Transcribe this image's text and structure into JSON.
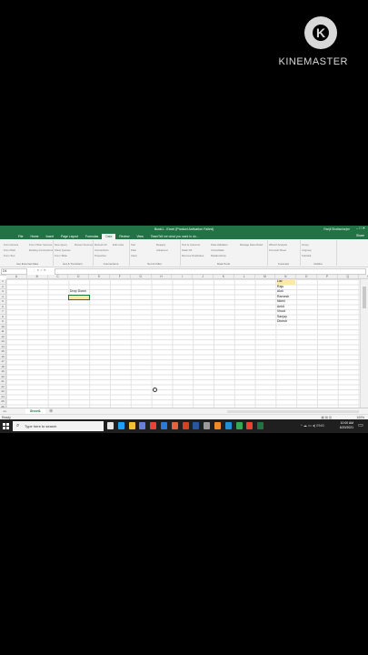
{
  "watermark": {
    "text": "KINEMASTER",
    "logo_icon": "kinemaster-logo-icon"
  },
  "excel": {
    "window_title": "Book1 - Excel (Product Activation Failed)",
    "account": "Ranjit Bhattacharjee",
    "tabs": [
      "File",
      "Home",
      "Insert",
      "Page Layout",
      "Formulas",
      "Data",
      "Review",
      "View",
      "Team"
    ],
    "active_tab": "Data",
    "tell_me": "Tell me what you want to do...",
    "share": "Share",
    "ribbon_groups": [
      {
        "label": "Get External Data",
        "items": [
          "From Access",
          "From Web",
          "From Text",
          "From Other Sources",
          "Existing Connections"
        ]
      },
      {
        "label": "Get & Transform",
        "items": [
          "New Query",
          "Show Queries",
          "From Table",
          "Recent Sources"
        ]
      },
      {
        "label": "Connections",
        "items": [
          "Refresh All",
          "Connections",
          "Properties",
          "Edit Links"
        ]
      },
      {
        "label": "Sort & Filter",
        "items": [
          "Sort",
          "Filter",
          "Clear",
          "Reapply",
          "Advanced"
        ]
      },
      {
        "label": "Data Tools",
        "items": [
          "Text to Columns",
          "Flash Fill",
          "Remove Duplicates",
          "Data Validation",
          "Consolidate",
          "Relationships",
          "Manage Data Model"
        ]
      },
      {
        "label": "Forecast",
        "items": [
          "What-If Analysis",
          "Forecast Sheet"
        ]
      },
      {
        "label": "Outline",
        "items": [
          "Group",
          "Ungroup",
          "Subtotal"
        ]
      }
    ],
    "name_box": "D4",
    "fx_icons": "⋮ ✕ ✓ fx",
    "columns": [
      "A",
      "B",
      "C",
      "D",
      "E",
      "F",
      "G",
      "H",
      "I",
      "J",
      "K",
      "L",
      "M",
      "N",
      "O",
      "P",
      "Q",
      "R",
      "S"
    ],
    "rows": [
      "1",
      "2",
      "3",
      "4",
      "5",
      "6",
      "7",
      "8",
      "9",
      "10",
      "11",
      "12",
      "13",
      "14",
      "15",
      "16",
      "17",
      "18",
      "19",
      "20",
      "21",
      "22",
      "23",
      "24",
      "25",
      "26",
      "27"
    ],
    "cells": {
      "D3": "Drop Down",
      "N1": "List",
      "N2": "Raju",
      "N3": "Alok",
      "N4": "Ramesh",
      "N5": "Nikhil",
      "N6": "Ankit",
      "N7": "Vinod",
      "N8": "Sanjay",
      "N9": "Dinesh"
    },
    "sheet_tab": "Sheet1",
    "add_sheet": "⊕",
    "status": "Ready",
    "zoom": "100%"
  },
  "taskbar": {
    "search_placeholder": "Type here to search",
    "time": "10:00 AM",
    "date": "6/20/2021",
    "tray": "^ ☁ ▭ ◂) ENG",
    "apps": [
      {
        "name": "task-view-icon",
        "color": "#e6e6e6"
      },
      {
        "name": "edge-icon",
        "color": "#1da1f2"
      },
      {
        "name": "file-explorer-icon",
        "color": "#f2c230"
      },
      {
        "name": "store-icon",
        "color": "#6a7fd8"
      },
      {
        "name": "chrome-icon",
        "color": "#e84335"
      },
      {
        "name": "mail-icon",
        "color": "#2c7ad6"
      },
      {
        "name": "media-player-icon",
        "color": "#e0663a"
      },
      {
        "name": "powerpoint-icon",
        "color": "#d04423"
      },
      {
        "name": "word-icon",
        "color": "#2b579a"
      },
      {
        "name": "photos-icon",
        "color": "#9a9a9a"
      },
      {
        "name": "vlc-icon",
        "color": "#f08a24"
      },
      {
        "name": "app-icon",
        "color": "#1f8fd8"
      },
      {
        "name": "chrome-icon-2",
        "color": "#34a853"
      },
      {
        "name": "media-icon-2",
        "color": "#e84335"
      },
      {
        "name": "excel-icon",
        "color": "#217346"
      }
    ]
  }
}
